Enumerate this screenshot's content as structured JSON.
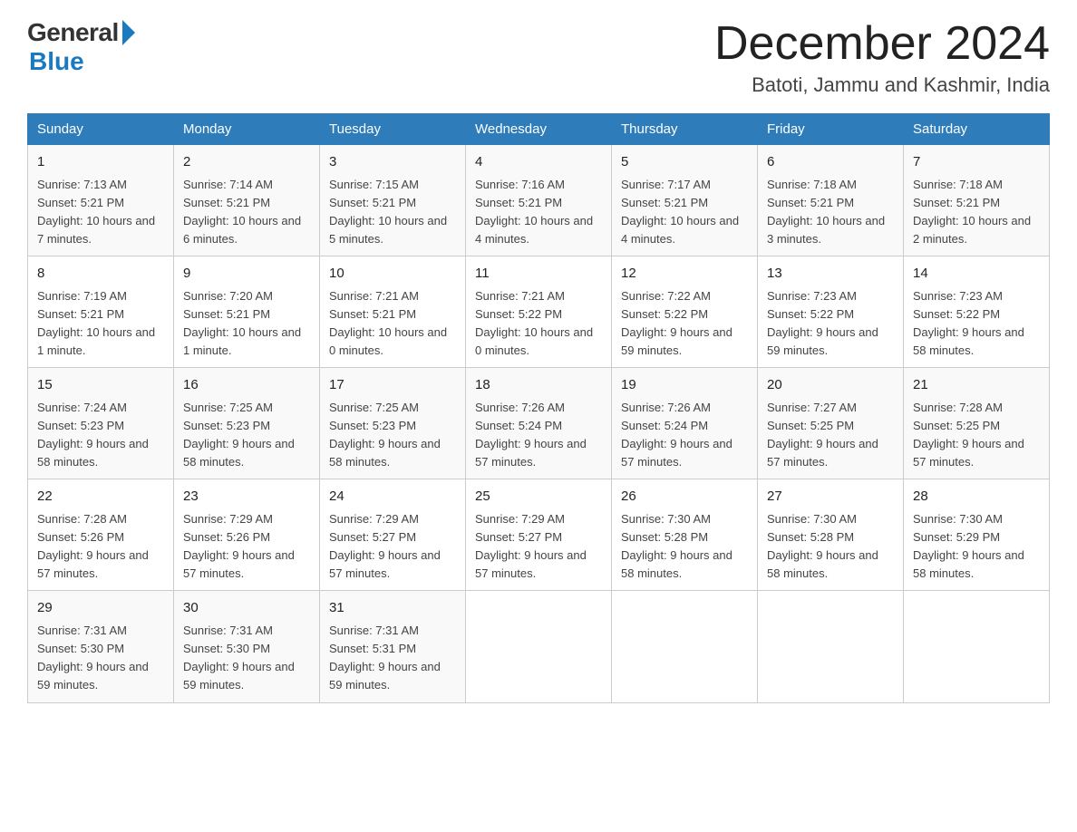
{
  "header": {
    "logo_general": "General",
    "logo_blue": "Blue",
    "month_title": "December 2024",
    "location": "Batoti, Jammu and Kashmir, India"
  },
  "days_of_week": [
    "Sunday",
    "Monday",
    "Tuesday",
    "Wednesday",
    "Thursday",
    "Friday",
    "Saturday"
  ],
  "weeks": [
    [
      {
        "day": "1",
        "sunrise": "7:13 AM",
        "sunset": "5:21 PM",
        "daylight": "10 hours and 7 minutes."
      },
      {
        "day": "2",
        "sunrise": "7:14 AM",
        "sunset": "5:21 PM",
        "daylight": "10 hours and 6 minutes."
      },
      {
        "day": "3",
        "sunrise": "7:15 AM",
        "sunset": "5:21 PM",
        "daylight": "10 hours and 5 minutes."
      },
      {
        "day": "4",
        "sunrise": "7:16 AM",
        "sunset": "5:21 PM",
        "daylight": "10 hours and 4 minutes."
      },
      {
        "day": "5",
        "sunrise": "7:17 AM",
        "sunset": "5:21 PM",
        "daylight": "10 hours and 4 minutes."
      },
      {
        "day": "6",
        "sunrise": "7:18 AM",
        "sunset": "5:21 PM",
        "daylight": "10 hours and 3 minutes."
      },
      {
        "day": "7",
        "sunrise": "7:18 AM",
        "sunset": "5:21 PM",
        "daylight": "10 hours and 2 minutes."
      }
    ],
    [
      {
        "day": "8",
        "sunrise": "7:19 AM",
        "sunset": "5:21 PM",
        "daylight": "10 hours and 1 minute."
      },
      {
        "day": "9",
        "sunrise": "7:20 AM",
        "sunset": "5:21 PM",
        "daylight": "10 hours and 1 minute."
      },
      {
        "day": "10",
        "sunrise": "7:21 AM",
        "sunset": "5:21 PM",
        "daylight": "10 hours and 0 minutes."
      },
      {
        "day": "11",
        "sunrise": "7:21 AM",
        "sunset": "5:22 PM",
        "daylight": "10 hours and 0 minutes."
      },
      {
        "day": "12",
        "sunrise": "7:22 AM",
        "sunset": "5:22 PM",
        "daylight": "9 hours and 59 minutes."
      },
      {
        "day": "13",
        "sunrise": "7:23 AM",
        "sunset": "5:22 PM",
        "daylight": "9 hours and 59 minutes."
      },
      {
        "day": "14",
        "sunrise": "7:23 AM",
        "sunset": "5:22 PM",
        "daylight": "9 hours and 58 minutes."
      }
    ],
    [
      {
        "day": "15",
        "sunrise": "7:24 AM",
        "sunset": "5:23 PM",
        "daylight": "9 hours and 58 minutes."
      },
      {
        "day": "16",
        "sunrise": "7:25 AM",
        "sunset": "5:23 PM",
        "daylight": "9 hours and 58 minutes."
      },
      {
        "day": "17",
        "sunrise": "7:25 AM",
        "sunset": "5:23 PM",
        "daylight": "9 hours and 58 minutes."
      },
      {
        "day": "18",
        "sunrise": "7:26 AM",
        "sunset": "5:24 PM",
        "daylight": "9 hours and 57 minutes."
      },
      {
        "day": "19",
        "sunrise": "7:26 AM",
        "sunset": "5:24 PM",
        "daylight": "9 hours and 57 minutes."
      },
      {
        "day": "20",
        "sunrise": "7:27 AM",
        "sunset": "5:25 PM",
        "daylight": "9 hours and 57 minutes."
      },
      {
        "day": "21",
        "sunrise": "7:28 AM",
        "sunset": "5:25 PM",
        "daylight": "9 hours and 57 minutes."
      }
    ],
    [
      {
        "day": "22",
        "sunrise": "7:28 AM",
        "sunset": "5:26 PM",
        "daylight": "9 hours and 57 minutes."
      },
      {
        "day": "23",
        "sunrise": "7:29 AM",
        "sunset": "5:26 PM",
        "daylight": "9 hours and 57 minutes."
      },
      {
        "day": "24",
        "sunrise": "7:29 AM",
        "sunset": "5:27 PM",
        "daylight": "9 hours and 57 minutes."
      },
      {
        "day": "25",
        "sunrise": "7:29 AM",
        "sunset": "5:27 PM",
        "daylight": "9 hours and 57 minutes."
      },
      {
        "day": "26",
        "sunrise": "7:30 AM",
        "sunset": "5:28 PM",
        "daylight": "9 hours and 58 minutes."
      },
      {
        "day": "27",
        "sunrise": "7:30 AM",
        "sunset": "5:28 PM",
        "daylight": "9 hours and 58 minutes."
      },
      {
        "day": "28",
        "sunrise": "7:30 AM",
        "sunset": "5:29 PM",
        "daylight": "9 hours and 58 minutes."
      }
    ],
    [
      {
        "day": "29",
        "sunrise": "7:31 AM",
        "sunset": "5:30 PM",
        "daylight": "9 hours and 59 minutes."
      },
      {
        "day": "30",
        "sunrise": "7:31 AM",
        "sunset": "5:30 PM",
        "daylight": "9 hours and 59 minutes."
      },
      {
        "day": "31",
        "sunrise": "7:31 AM",
        "sunset": "5:31 PM",
        "daylight": "9 hours and 59 minutes."
      },
      null,
      null,
      null,
      null
    ]
  ]
}
